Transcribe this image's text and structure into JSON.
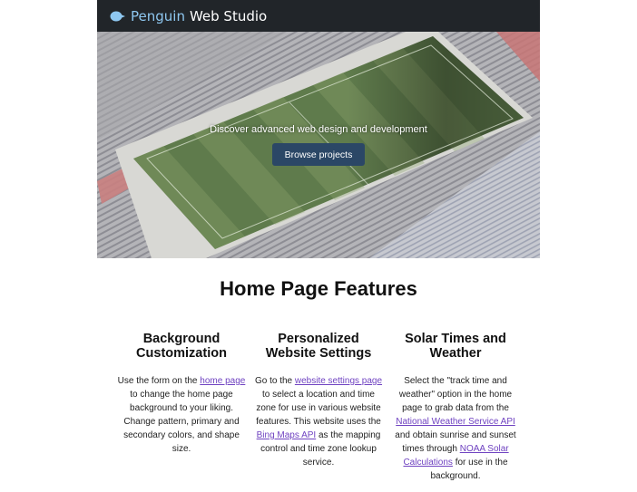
{
  "navbar": {
    "brand_accent": "Penguin",
    "brand_rest": "Web Studio",
    "brand_icon": "penguin-logo-icon"
  },
  "hero": {
    "tagline": "Discover advanced web design and development",
    "button_label": "Browse projects"
  },
  "features": {
    "title": "Home Page Features",
    "items": [
      {
        "title_line1": "Background",
        "title_line2": "Customization",
        "text_before": "Use the form on the ",
        "link1": "home page",
        "text_after": " to change the home page background to your liking. Change pattern, primary and secondary colors, and shape size."
      },
      {
        "title_line1": "Personalized",
        "title_line2": "Website Settings",
        "text_before": "Go to the ",
        "link1": "website settings page",
        "text_middle": " to select a location and time zone for use in various website features. This website uses the ",
        "link2": "Bing Maps API",
        "text_after": " as the mapping control and time zone lookup service."
      },
      {
        "title_line1": "Solar Times and",
        "title_line2": "Weather",
        "text_before": "Select the \"track time and weather\" option in the home page to grab data from the ",
        "link1": "National Weather Service API",
        "text_middle": " and obtain sunrise and sunset times through ",
        "link2": "NOAA Solar Calculations",
        "text_after": " for use in the background."
      }
    ]
  },
  "colors": {
    "navbar_bg": "#212529",
    "brand_accent": "#8ec7f0",
    "button_bg": "#2b4766",
    "link": "#6f42c1"
  }
}
